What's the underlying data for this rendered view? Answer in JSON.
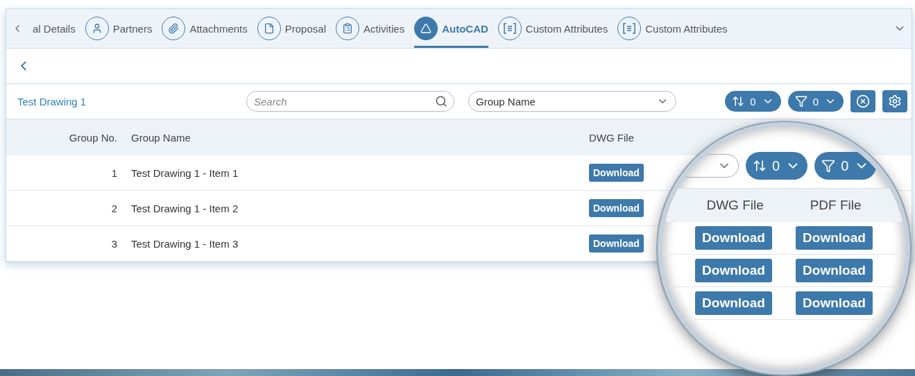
{
  "tabs": [
    {
      "label": "al Details",
      "selected": false
    },
    {
      "label": "Partners",
      "selected": false
    },
    {
      "label": "Attachments",
      "selected": false
    },
    {
      "label": "Proposal",
      "selected": false
    },
    {
      "label": "Activities",
      "selected": false
    },
    {
      "label": "AutoCAD",
      "selected": true
    },
    {
      "label": "Custom Attributes",
      "selected": false
    },
    {
      "label": "Custom Attributes",
      "selected": false
    }
  ],
  "toolbar": {
    "title": "Test Drawing 1",
    "search_placeholder": "Search",
    "group_by": "Group Name",
    "sort_count": "0",
    "filter_count": "0"
  },
  "table": {
    "columns": [
      "Group No.",
      "Group Name",
      "DWG File"
    ],
    "rows": [
      {
        "group_no": "1",
        "group_name": "Test Drawing 1 - Item 1",
        "dwg": "Download"
      },
      {
        "group_no": "2",
        "group_name": "Test Drawing 1 - Item 2",
        "dwg": "Download"
      },
      {
        "group_no": "3",
        "group_name": "Test Drawing 1 - Item 3",
        "dwg": "Download"
      }
    ]
  },
  "magnifier": {
    "sort_count": "0",
    "filter_count": "0",
    "columns": [
      "DWG File",
      "PDF File"
    ],
    "rows": [
      [
        "Download",
        "Download"
      ],
      [
        "Download",
        "Download"
      ],
      [
        "Download",
        "Download"
      ]
    ]
  }
}
